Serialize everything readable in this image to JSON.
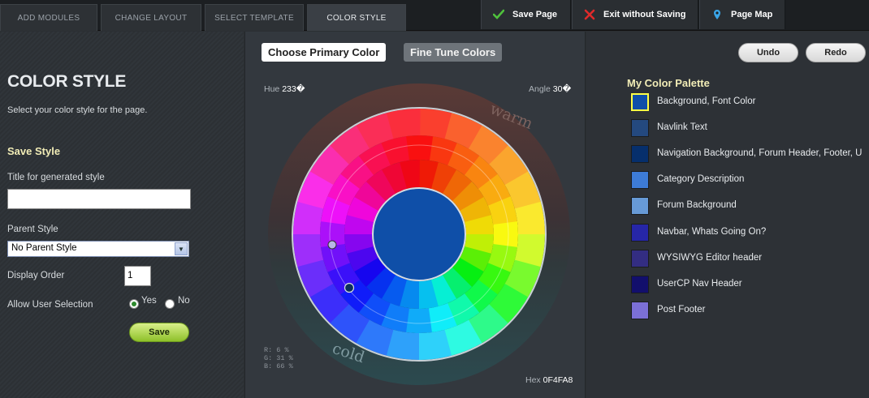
{
  "topbar": {
    "tabs": [
      {
        "label": "ADD MODULES"
      },
      {
        "label": "CHANGE LAYOUT"
      },
      {
        "label": "SELECT TEMPLATE"
      },
      {
        "label": "COLOR STYLE"
      }
    ],
    "actions": [
      {
        "label": "Save Page",
        "icon": "check-icon",
        "color": "#4fc13c"
      },
      {
        "label": "Exit without Saving",
        "icon": "x-icon",
        "color": "#e02a2a"
      },
      {
        "label": "Page Map",
        "icon": "map-pin-icon",
        "color": "#3aa5e8"
      }
    ]
  },
  "left": {
    "title": "COLOR STYLE",
    "subtitle": "Select your color style for the page.",
    "save_heading": "Save Style",
    "title_label": "Title for generated style",
    "title_value": "",
    "parent_label": "Parent Style",
    "parent_value": "No Parent Style",
    "order_label": "Display Order",
    "order_value": "1",
    "allow_label": "Allow User Selection",
    "yes_label": "Yes",
    "no_label": "No",
    "save_button": "Save"
  },
  "center": {
    "choose_primary": "Choose Primary Color",
    "fine_tune": "Fine Tune Colors",
    "hue_label": "Hue",
    "hue_value": "233�",
    "angle_label": "Angle",
    "angle_value": "30�",
    "warm": "warm",
    "cold": "cold",
    "rgb_r": "R:  6 %",
    "rgb_g": "G: 31 %",
    "rgb_b": "B: 66 %",
    "hex_label": "Hex",
    "hex_value": "0F4FA8",
    "primary_color": "#0F4FA8"
  },
  "right": {
    "undo": "Undo",
    "redo": "Redo",
    "palette_title": "My Color Palette",
    "palette": [
      {
        "label": "Background, Font Color",
        "color": "#0F4FA8",
        "selected": true
      },
      {
        "label": "Navlink Text",
        "color": "#24497f"
      },
      {
        "label": "Navigation Background, Forum Header, Footer, U",
        "color": "#062f6c"
      },
      {
        "label": "Category Description",
        "color": "#3d7bd6"
      },
      {
        "label": "Forum Background",
        "color": "#679ad6"
      },
      {
        "label": "Navbar, Whats Going On?",
        "color": "#2626a8"
      },
      {
        "label": "WYSIWYG Editor header",
        "color": "#332d82"
      },
      {
        "label": "UserCP Nav Header",
        "color": "#120f6c"
      },
      {
        "label": "Post Footer",
        "color": "#7b6fd6"
      }
    ]
  }
}
